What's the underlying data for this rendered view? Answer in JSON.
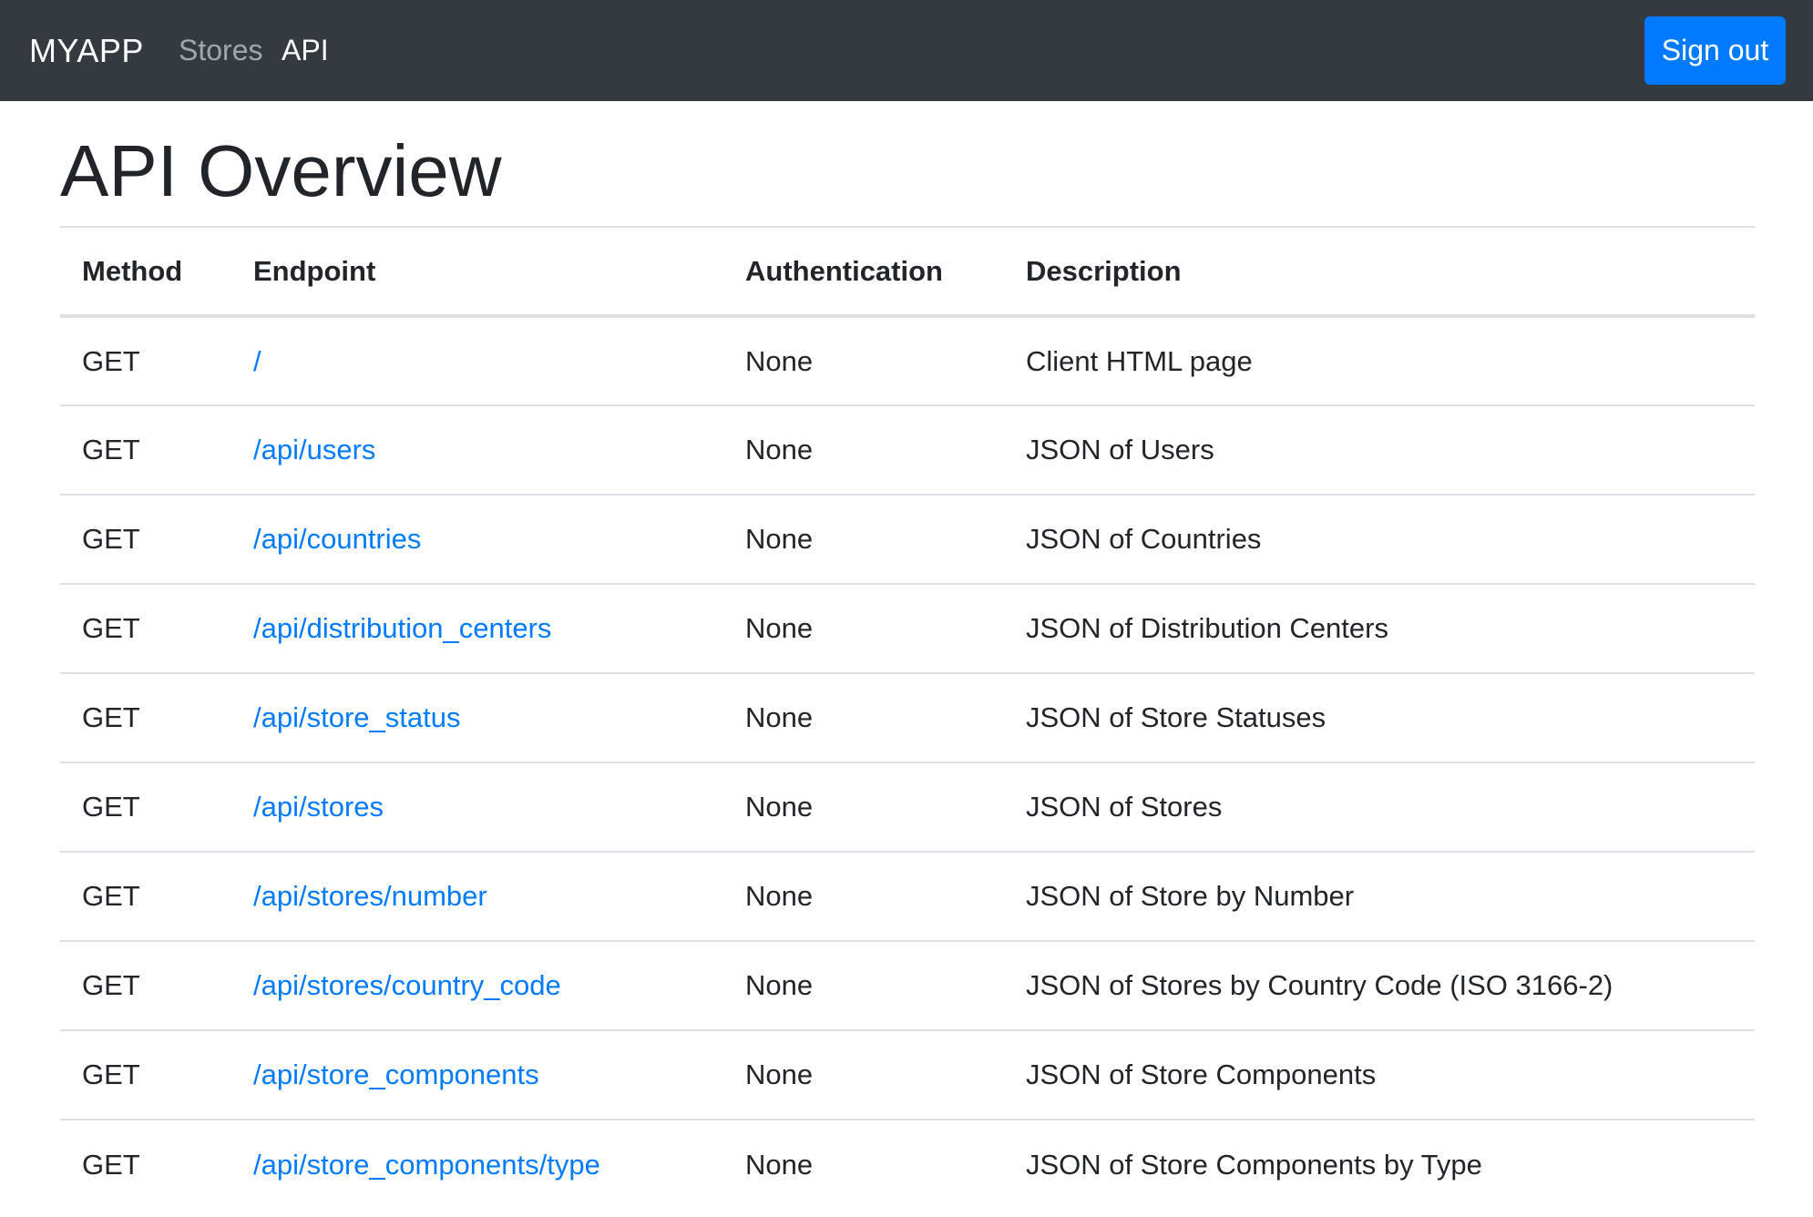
{
  "navbar": {
    "brand": "MYAPP",
    "links": [
      {
        "label": "Stores",
        "active": false
      },
      {
        "label": "API",
        "active": true
      }
    ],
    "signout_label": "Sign out"
  },
  "page": {
    "title": "API Overview"
  },
  "table": {
    "headers": [
      "Method",
      "Endpoint",
      "Authentication",
      "Description"
    ],
    "rows": [
      {
        "method": "GET",
        "endpoint": "/",
        "auth": "None",
        "description": "Client HTML page"
      },
      {
        "method": "GET",
        "endpoint": "/api/users",
        "auth": "None",
        "description": "JSON of Users"
      },
      {
        "method": "GET",
        "endpoint": "/api/countries",
        "auth": "None",
        "description": "JSON of Countries"
      },
      {
        "method": "GET",
        "endpoint": "/api/distribution_centers",
        "auth": "None",
        "description": "JSON of Distribution Centers"
      },
      {
        "method": "GET",
        "endpoint": "/api/store_status",
        "auth": "None",
        "description": "JSON of Store Statuses"
      },
      {
        "method": "GET",
        "endpoint": "/api/stores",
        "auth": "None",
        "description": "JSON of Stores"
      },
      {
        "method": "GET",
        "endpoint": "/api/stores/number",
        "auth": "None",
        "description": "JSON of Store by Number"
      },
      {
        "method": "GET",
        "endpoint": "/api/stores/country_code",
        "auth": "None",
        "description": "JSON of Stores by Country Code (ISO 3166-2)"
      },
      {
        "method": "GET",
        "endpoint": "/api/store_components",
        "auth": "None",
        "description": "JSON of Store Components"
      },
      {
        "method": "GET",
        "endpoint": "/api/store_components/type",
        "auth": "None",
        "description": "JSON of Store Components by Type"
      }
    ]
  },
  "colors": {
    "navbar_bg": "#343a40",
    "primary": "#007bff",
    "link": "#007bff",
    "text": "#212529",
    "border": "#dee2e6"
  }
}
